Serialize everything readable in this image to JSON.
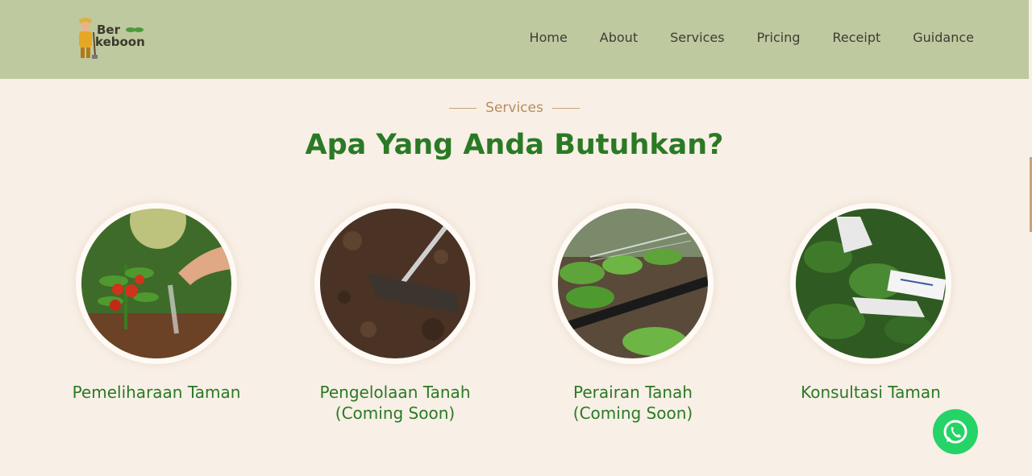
{
  "header": {
    "logo": {
      "line1": "Ber",
      "line2": "keboon"
    },
    "nav": [
      "Home",
      "About",
      "Services",
      "Pricing",
      "Receipt",
      "Guidance"
    ]
  },
  "section": {
    "eyebrow": "Services",
    "title": "Apa Yang Anda Butuhkan?",
    "cards": [
      {
        "label": "Pemeliharaan Taman"
      },
      {
        "label": "Pengelolaan Tanah",
        "note": "(Coming Soon)"
      },
      {
        "label": "Perairan Tanah",
        "note": "(Coming Soon)"
      },
      {
        "label": "Konsultasi Taman"
      }
    ]
  },
  "colors": {
    "header_bg": "#bfc9a0",
    "page_bg": "#f8efe6",
    "title_green": "#2a7a25",
    "accent_tan": "#b98c5c",
    "whatsapp_green": "#25d366"
  }
}
